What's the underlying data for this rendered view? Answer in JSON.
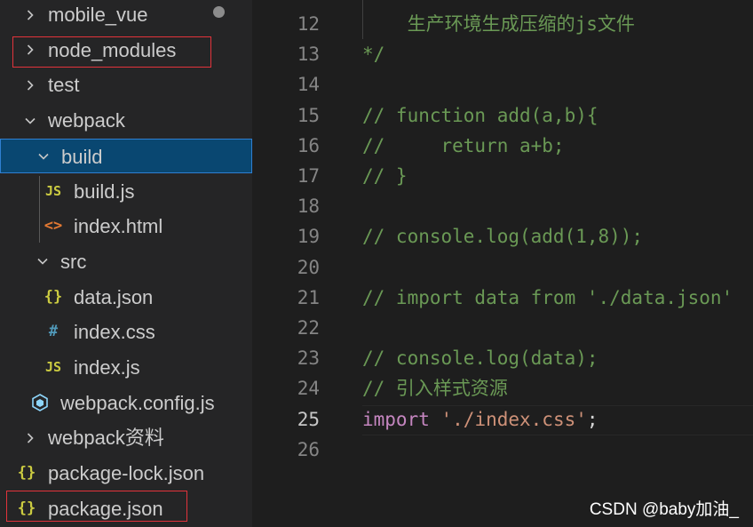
{
  "explorer": {
    "items": [
      {
        "label": "mobile_vue",
        "icon": "chevron-right-icon",
        "icon_glyph": ""
      },
      {
        "label": "node_modules",
        "icon": "chevron-right-icon",
        "icon_glyph": ""
      },
      {
        "label": "test",
        "icon": "chevron-right-icon",
        "icon_glyph": ""
      },
      {
        "label": "webpack",
        "icon": "chevron-down-icon",
        "icon_glyph": ""
      },
      {
        "label": "build",
        "icon": "chevron-down-icon",
        "icon_glyph": ""
      },
      {
        "label": "build.js",
        "icon": "js-file-icon",
        "icon_glyph": "JS"
      },
      {
        "label": "index.html",
        "icon": "html-file-icon",
        "icon_glyph": "<>"
      },
      {
        "label": "src",
        "icon": "chevron-down-icon",
        "icon_glyph": ""
      },
      {
        "label": "data.json",
        "icon": "json-file-icon",
        "icon_glyph": "{}"
      },
      {
        "label": "index.css",
        "icon": "css-file-icon",
        "icon_glyph": "#"
      },
      {
        "label": "index.js",
        "icon": "js-file-icon",
        "icon_glyph": "JS"
      },
      {
        "label": "webpack.config.js",
        "icon": "webpack-file-icon",
        "icon_glyph": ""
      },
      {
        "label": "webpack资料",
        "icon": "chevron-right-icon",
        "icon_glyph": ""
      },
      {
        "label": "package-lock.json",
        "icon": "json-file-icon",
        "icon_glyph": "{}"
      },
      {
        "label": "package.json",
        "icon": "json-file-icon",
        "icon_glyph": "{}"
      }
    ],
    "selected_label": "build",
    "colors": {
      "selected_bg": "#094771",
      "js": "#cbcb41",
      "html": "#e37933",
      "json": "#cbcb41",
      "css": "#519aba",
      "webpack": "#8ed6fb",
      "annotation_box": "#e2333b"
    }
  },
  "editor": {
    "current_line": "25",
    "lines": [
      {
        "n": "12",
        "segments": [
          {
            "t": "    生产环境生成压缩的js文件",
            "c": "cm"
          }
        ]
      },
      {
        "n": "13",
        "segments": [
          {
            "t": "*/",
            "c": "cm"
          }
        ]
      },
      {
        "n": "14",
        "segments": []
      },
      {
        "n": "15",
        "segments": [
          {
            "t": "// function add(a,b){",
            "c": "cm"
          }
        ]
      },
      {
        "n": "16",
        "segments": [
          {
            "t": "//     return a+b;",
            "c": "cm"
          }
        ]
      },
      {
        "n": "17",
        "segments": [
          {
            "t": "// }",
            "c": "cm"
          }
        ]
      },
      {
        "n": "18",
        "segments": []
      },
      {
        "n": "19",
        "segments": [
          {
            "t": "// console.log(add(1,8));",
            "c": "cm"
          }
        ]
      },
      {
        "n": "20",
        "segments": []
      },
      {
        "n": "21",
        "segments": [
          {
            "t": "// import data from './data.json'",
            "c": "cm"
          }
        ]
      },
      {
        "n": "22",
        "segments": []
      },
      {
        "n": "23",
        "segments": [
          {
            "t": "// console.log(data);",
            "c": "cm"
          }
        ]
      },
      {
        "n": "24",
        "segments": [
          {
            "t": "// 引入样式资源",
            "c": "cm"
          }
        ]
      },
      {
        "n": "25",
        "segments": [
          {
            "t": "import",
            "c": "kw"
          },
          {
            "t": " ",
            "c": "punc"
          },
          {
            "t": "'./index.css'",
            "c": "str"
          },
          {
            "t": ";",
            "c": "punc"
          }
        ]
      },
      {
        "n": "26",
        "segments": []
      }
    ],
    "colors": {
      "comment": "#6a9955",
      "keyword": "#c586c0",
      "string": "#ce9178",
      "line_number": "#858585"
    }
  },
  "watermark": "CSDN @baby加油_"
}
